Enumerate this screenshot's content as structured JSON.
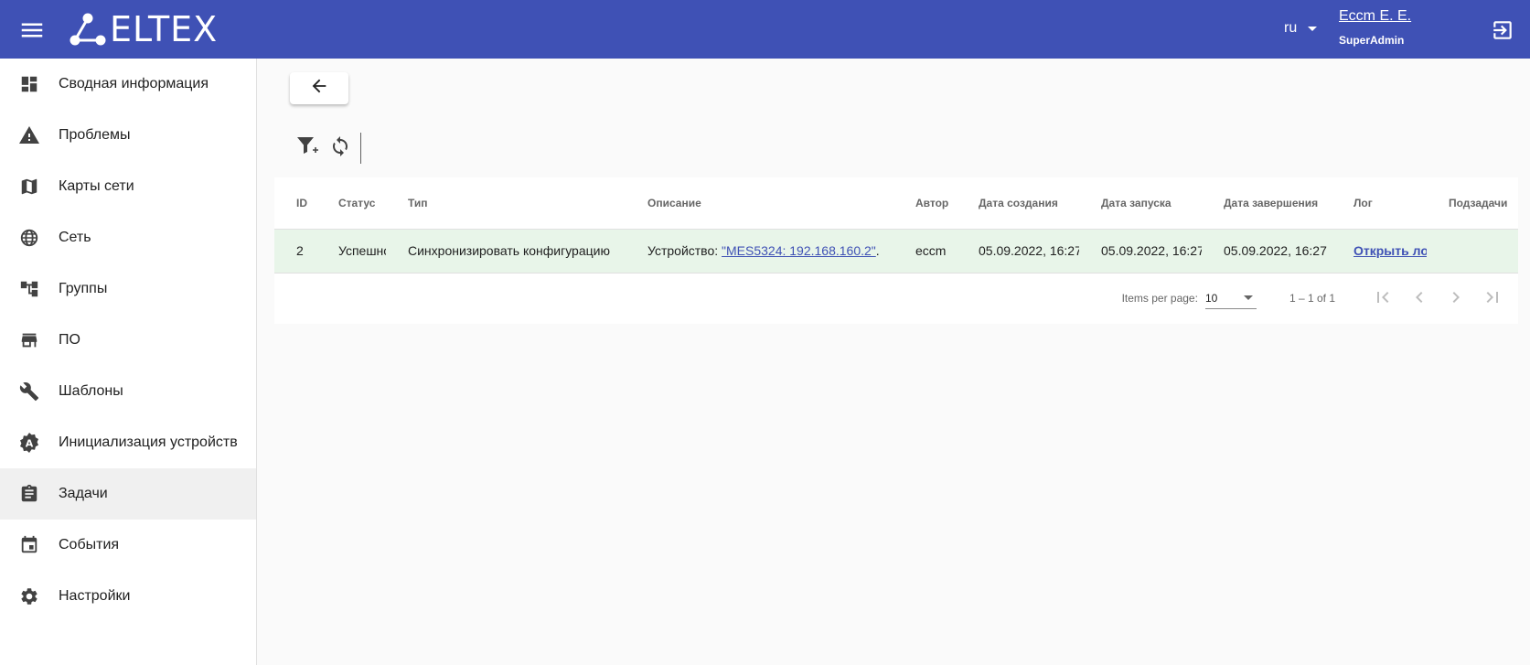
{
  "header": {
    "logo_text": "ELTEX",
    "lang": "ru",
    "user_name": "Eccm E. E.",
    "user_role": "SuperAdmin",
    "bg_color": "#3f51b5",
    "icons": {
      "menu": "menu-icon",
      "logout": "logout-icon",
      "lang_caret": "caret-down-icon"
    }
  },
  "sidebar": {
    "items": [
      {
        "label": "Сводная информация",
        "icon": "dashboard-icon"
      },
      {
        "label": "Проблемы",
        "icon": "warning-icon"
      },
      {
        "label": "Карты сети",
        "icon": "map-icon"
      },
      {
        "label": "Сеть",
        "icon": "globe-icon"
      },
      {
        "label": "Группы",
        "icon": "account-tree-icon"
      },
      {
        "label": "ПО",
        "icon": "store-icon"
      },
      {
        "label": "Шаблоны",
        "icon": "wrench-icon"
      },
      {
        "label": "Инициализация устройств",
        "icon": "auto-badge-icon"
      },
      {
        "label": "Задачи",
        "icon": "assignment-icon",
        "active": true
      },
      {
        "label": "События",
        "icon": "calendar-icon"
      },
      {
        "label": "Настройки",
        "icon": "gear-icon"
      }
    ]
  },
  "toolbar": {
    "back_icon": "arrow-left-icon",
    "filter_icon": "filter-add-icon",
    "refresh_icon": "refresh-icon"
  },
  "table": {
    "columns": [
      "ID",
      "Статус",
      "Тип",
      "Описание",
      "Автор",
      "Дата создания",
      "Дата запуска",
      "Дата завершения",
      "Лог",
      "Подзадачи"
    ],
    "rows": [
      {
        "id": "2",
        "status": "Успешно",
        "type": "Синхронизировать конфигурацию",
        "description_prefix": "Устройство: ",
        "description_link": "\"MES5324: 192.168.160.2\"",
        "description_suffix": ".",
        "author": "eccm",
        "created": "05.09.2022, 16:27",
        "started": "05.09.2022, 16:27",
        "finished": "05.09.2022, 16:27",
        "log_link": "Открыть лог",
        "subtasks": "",
        "row_color": "#e8f5e9"
      }
    ]
  },
  "paginator": {
    "items_per_page_label": "Items per page:",
    "items_per_page_value": "10",
    "range": "1 – 1 of 1",
    "icons": [
      "first-page-icon",
      "chevron-left-icon",
      "chevron-right-icon",
      "last-page-icon"
    ]
  }
}
